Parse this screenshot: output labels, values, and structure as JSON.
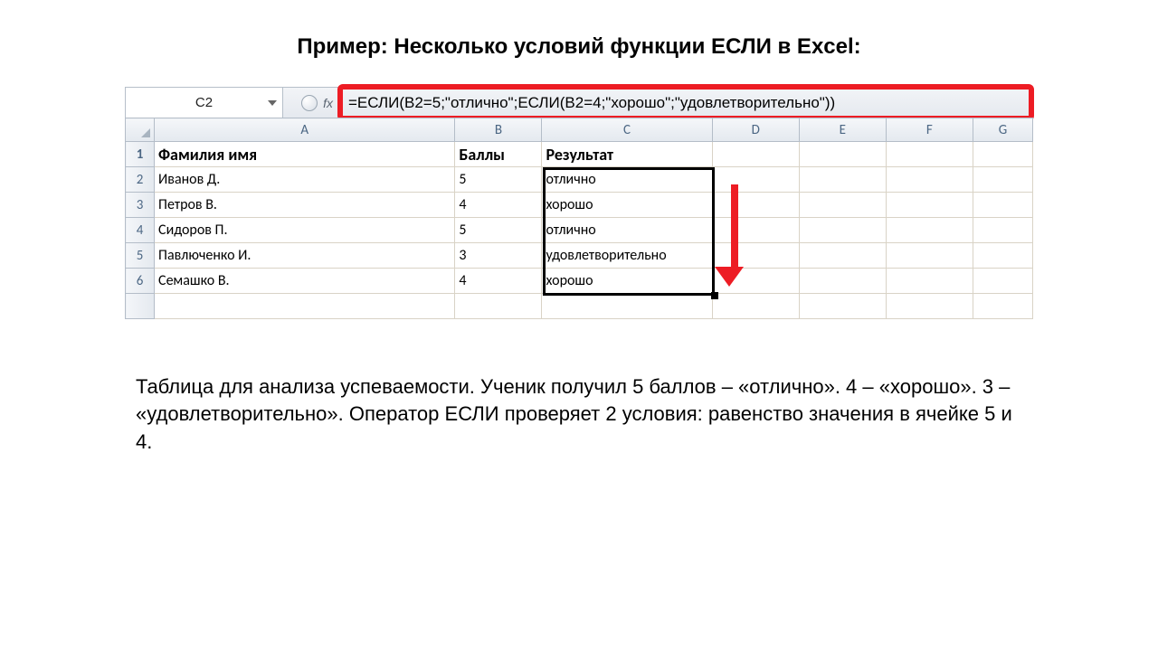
{
  "title": "Пример: Несколько условий функции ЕСЛИ в Excel:",
  "cellRef": "C2",
  "fxLabel": "fx",
  "formula": "=ЕСЛИ(B2=5;\"отлично\";ЕСЛИ(B2=4;\"хорошо\";\"удовлетворительно\"))",
  "cols": {
    "A": "A",
    "B": "B",
    "C": "C",
    "D": "D",
    "E": "E",
    "F": "F",
    "G": "G"
  },
  "rn": {
    "r1": "1",
    "r2": "2",
    "r3": "3",
    "r4": "4",
    "r5": "5",
    "r6": "6"
  },
  "head": {
    "a": "Фамилия имя",
    "b": "Баллы",
    "c": "Результат"
  },
  "rows": [
    {
      "name": "Иванов Д.",
      "score": "5",
      "res": "отлично"
    },
    {
      "name": "Петров В.",
      "score": "4",
      "res": "хорошо"
    },
    {
      "name": "Сидоров П.",
      "score": "5",
      "res": "отлично"
    },
    {
      "name": "Павлюченко И.",
      "score": "3",
      "res": "удовлетворительно"
    },
    {
      "name": "Семашко В.",
      "score": "4",
      "res": "хорошо"
    }
  ],
  "description": "Таблица для анализа успеваемости. Ученик получил 5 баллов – «отлично». 4 – «хорошо». 3 – «удовлетворительно». Оператор ЕСЛИ проверяет 2 условия: равенство значения в ячейке 5 и 4."
}
